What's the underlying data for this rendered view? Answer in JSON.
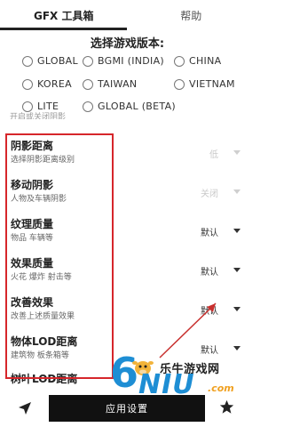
{
  "tabs": [
    {
      "label": "GFX 工具箱",
      "active": true
    },
    {
      "label": "帮助",
      "active": false
    }
  ],
  "version_title": "选择游戏版本:",
  "versions": [
    "GLOBAL",
    "BGMI (INDIA)",
    "CHINA",
    "KOREA",
    "TAIWAN",
    "VIETNAM",
    "LITE",
    "GLOBAL (BETA)"
  ],
  "cut_label": "开启或关闭阴影",
  "settings": [
    {
      "name": "阴影距离",
      "desc": "选择阴影距离级别",
      "value": "低",
      "enabled": false
    },
    {
      "name": "移动阴影",
      "desc": "人物及车辆阴影",
      "value": "关闭",
      "enabled": false
    },
    {
      "name": "纹理质量",
      "desc": "物品 车辆等",
      "value": "默认",
      "enabled": true
    },
    {
      "name": "效果质量",
      "desc": "火花 爆炸 射击等",
      "value": "默认",
      "enabled": true
    },
    {
      "name": "改善效果",
      "desc": "改善上述质量效果",
      "value": "默认",
      "enabled": true
    },
    {
      "name": "物体LOD距离",
      "desc": "建筑物 板条箱等",
      "value": "默认",
      "enabled": true
    },
    {
      "name": "树叶LOD距离",
      "desc": "",
      "value": "",
      "enabled": true
    }
  ],
  "apply_button": "应用设置",
  "watermark": {
    "site": "乐牛游戏网",
    "logo": "6NIU",
    "suffix": ".com"
  },
  "icons": {
    "send": "send-icon",
    "star": "star-icon"
  },
  "colors": {
    "highlight_box": "#d6262b",
    "button_bg": "#111111",
    "logo_blue": "#1e8ed4"
  }
}
